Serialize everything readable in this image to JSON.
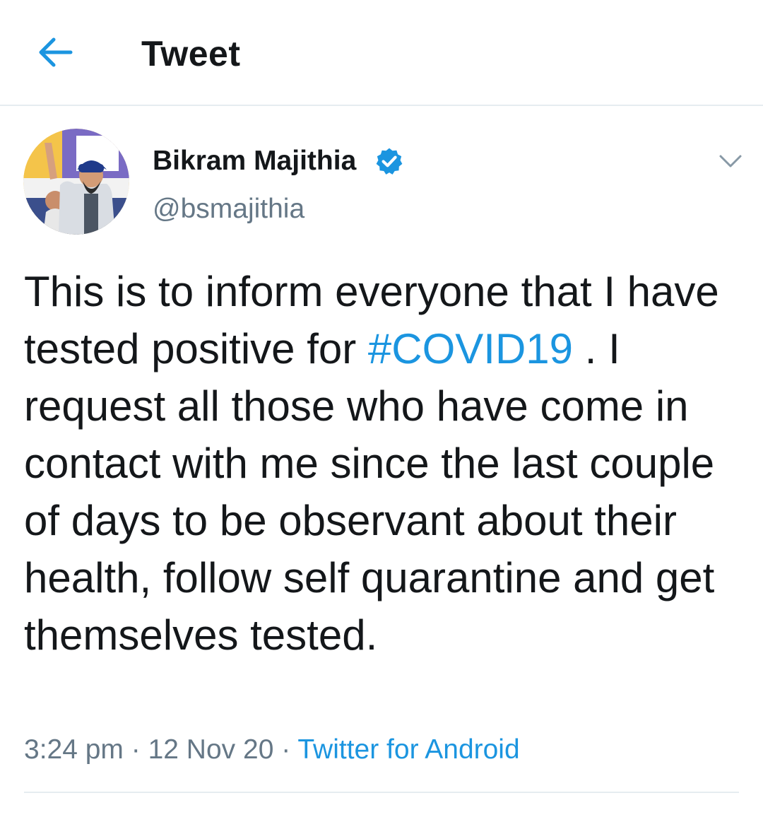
{
  "header": {
    "title": "Tweet",
    "back_icon": "arrow-left-icon"
  },
  "author": {
    "name": "Bikram Majithia",
    "handle": "@bsmajithia",
    "verified": true,
    "verified_icon": "verified-badge-icon",
    "menu_icon": "chevron-down-icon"
  },
  "tweet": {
    "text_before": "This is to inform everyone that I have tested positive for ",
    "hashtag": "#COVID19",
    "text_after": " . I request all those who have come in contact with me since the last couple of days to be observant about their health, follow self quarantine and get themselves tested."
  },
  "meta": {
    "time": "3:24 pm",
    "separator_1": " · ",
    "date": "12 Nov 20",
    "separator_2": " · ",
    "source": "Twitter for Android"
  },
  "colors": {
    "accent": "#1b95e0",
    "text": "#14171a",
    "secondary": "#657786",
    "divider": "#e6ecf0"
  }
}
